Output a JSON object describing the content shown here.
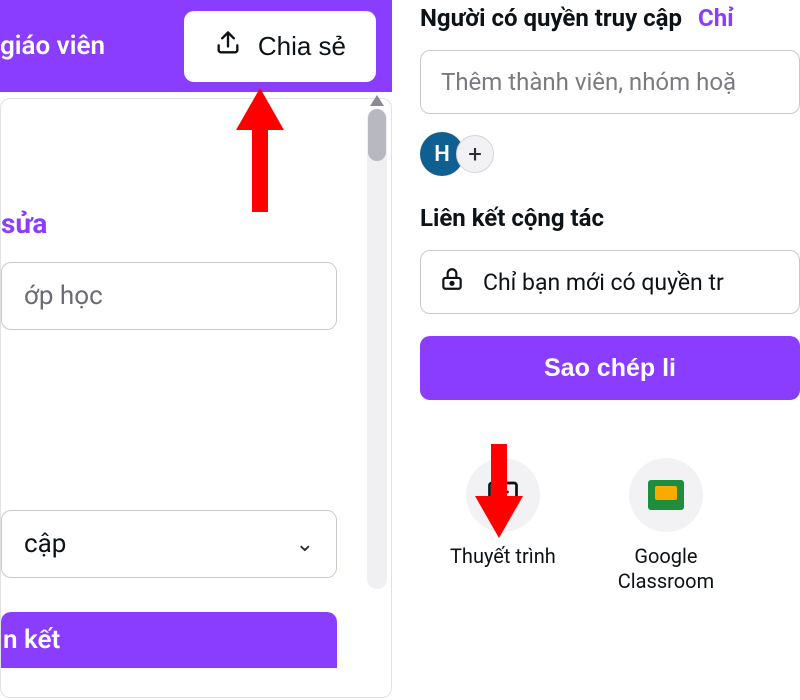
{
  "left": {
    "header_role": "giáo viên",
    "share_label": "Chia sẻ",
    "edit_heading": "sửa",
    "class_input_placeholder": "ớp học",
    "access_dropdown_label": "cập",
    "link_strip_label": "n kết"
  },
  "right": {
    "access_heading": "Người có quyền truy cập",
    "access_link_text": "Chỉ",
    "add_member_placeholder": "Thêm thành viên, nhóm hoặ",
    "avatar_initial": "H",
    "collab_heading": "Liên kết cộng tác",
    "lock_text": "Chỉ bạn mới có quyền tr",
    "copy_button_label": "Sao chép li",
    "options": [
      {
        "label": "Thuyết trình"
      },
      {
        "label": "Google\nClassroom"
      }
    ]
  }
}
